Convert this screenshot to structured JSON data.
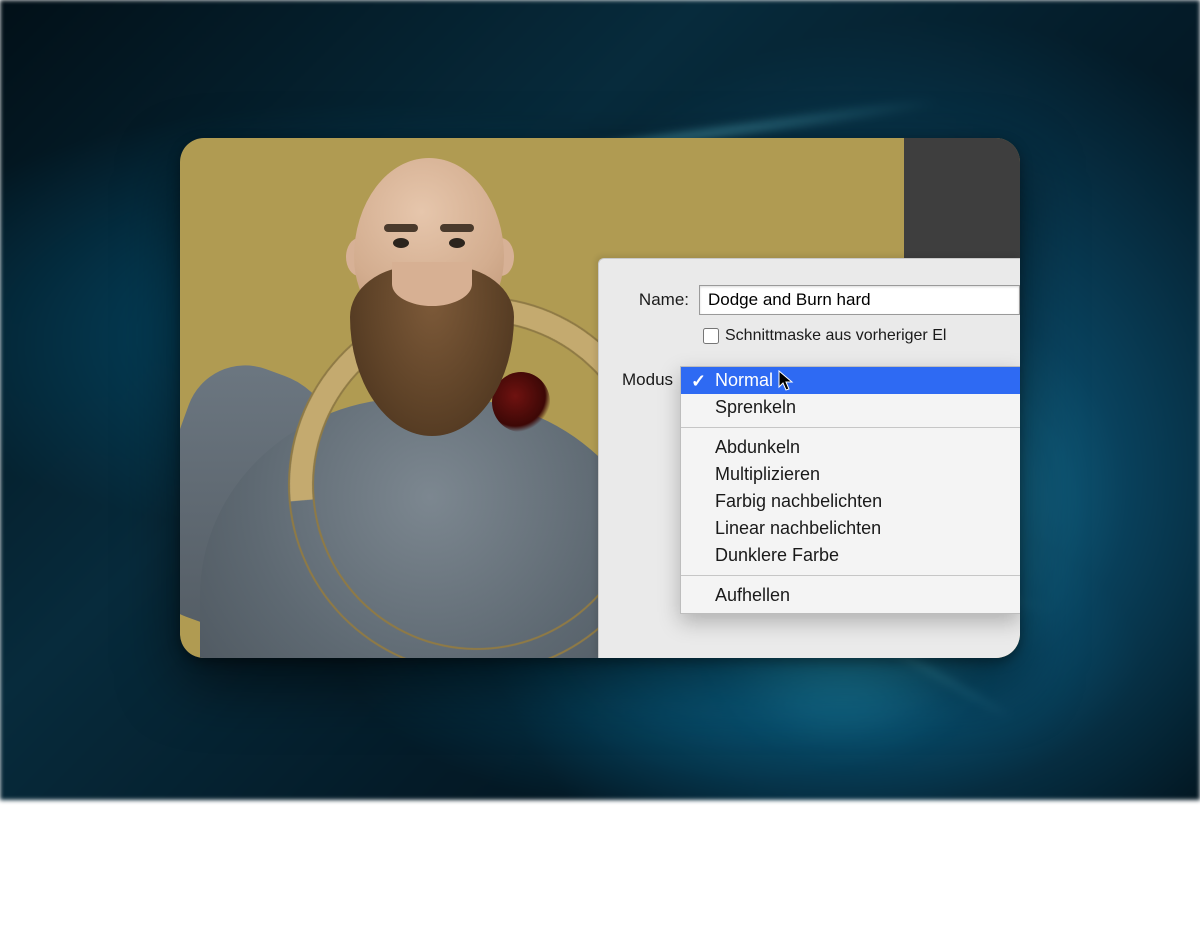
{
  "dialog": {
    "name_label": "Name:",
    "name_value": "Dodge and Burn hard",
    "clipmask_checkbox_label": "Schnittmaske aus vorheriger El",
    "clipmask_checked": false,
    "modus_label": "Modus"
  },
  "modus_menu": {
    "selected_index": 0,
    "groups": [
      [
        "Normal",
        "Sprenkeln"
      ],
      [
        "Abdunkeln",
        "Multiplizieren",
        "Farbig nachbelichten",
        "Linear nachbelichten",
        "Dunklere Farbe"
      ],
      [
        "Aufhellen"
      ]
    ]
  },
  "colors": {
    "canvas_bg": "#b09b52",
    "panel_bg": "#eaeaea",
    "selection_bg": "#2e6af3"
  }
}
